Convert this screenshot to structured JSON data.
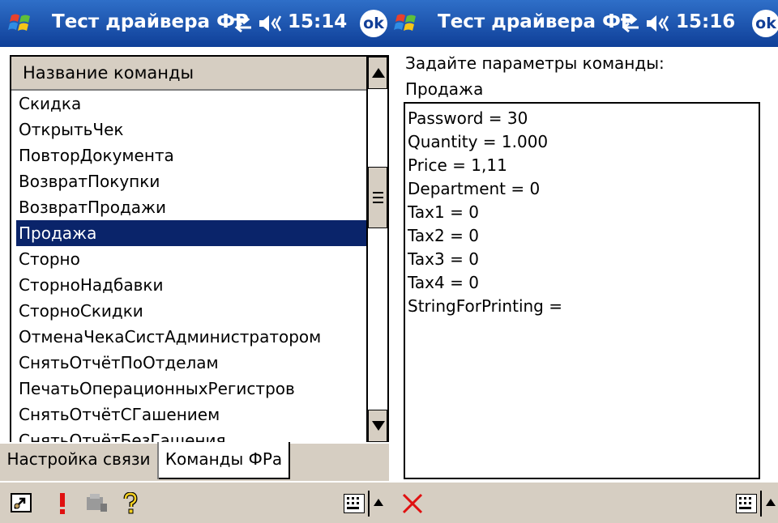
{
  "left_screen": {
    "title": "Тест драйвера ФР",
    "clock": "15:14",
    "ok_label": "ok",
    "list": {
      "header": "Название команды",
      "items": [
        "Скидка",
        "ОткрытьЧек",
        "ПовторДокумента",
        "ВозвратПокупки",
        "ВозвратПродажи",
        "Продажа",
        "Сторно",
        "СторноНадбавки",
        "СторноСкидки",
        "ОтменаЧекаСистАдминистратором",
        "СнятьОтчётПоОтделам",
        "ПечатьОперационныхРегистров",
        "СнятьОтчётСГашением",
        "СнятьОтчётБезГашения"
      ],
      "selected": "Продажа"
    },
    "tabs": [
      "Настройка связи",
      "Команды ФРа"
    ],
    "active_tab": "Команды ФРа",
    "toolbar_icons": [
      "connect-icon",
      "exclamation-icon",
      "device-icon",
      "help-icon",
      "keyboard-icon"
    ]
  },
  "right_screen": {
    "title": "Тест драйвера ФР",
    "clock": "15:16",
    "ok_label": "ok",
    "prompt": "Задайте параметры команды:",
    "command": "Продажа",
    "params": [
      "Password = 30",
      "Quantity = 1.000",
      "Price = 1,11",
      "Department = 0",
      "Tax1 = 0",
      "Tax2 = 0",
      "Tax3 = 0",
      "Tax4 = 0",
      "StringForPrinting ="
    ],
    "toolbar_icons": [
      "close-icon",
      "keyboard-icon"
    ]
  },
  "colors": {
    "title_bar": "#1f5bb8",
    "selection": "#0a246a",
    "chrome": "#d6cec2",
    "close_red": "#e01010"
  }
}
